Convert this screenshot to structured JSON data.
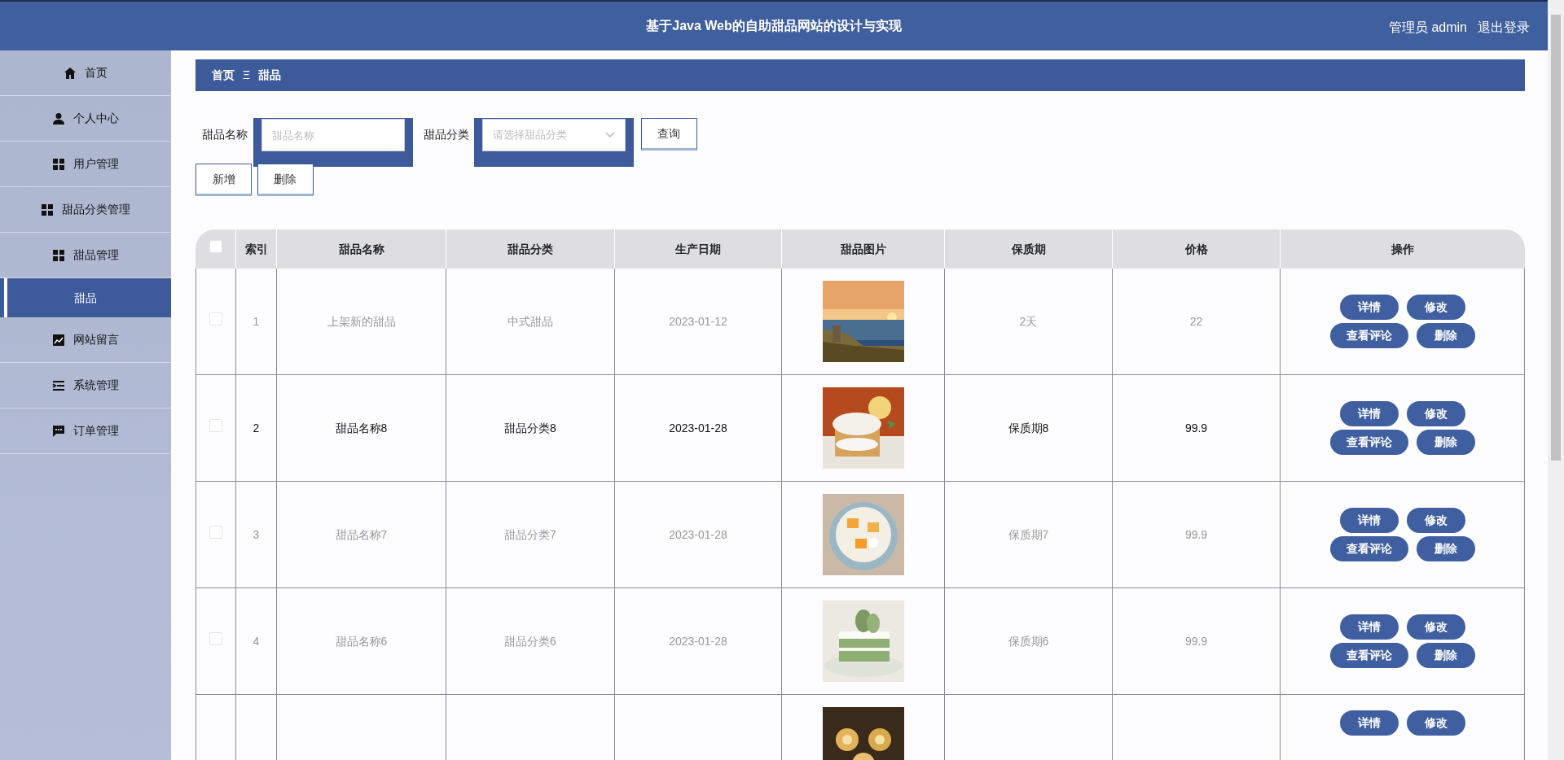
{
  "header": {
    "title": "基于Java Web的自助甜品网站的设计与实现",
    "user": "管理员 admin",
    "logout": "退出登录"
  },
  "sidebar": {
    "items": [
      {
        "label": "首页",
        "selected": false
      },
      {
        "label": "个人中心",
        "selected": false
      },
      {
        "label": "用户管理",
        "selected": false
      },
      {
        "label": "甜品分类管理",
        "selected": false
      },
      {
        "label": "甜品管理",
        "selected": false,
        "children": [
          {
            "label": "甜品",
            "selected": true
          }
        ]
      },
      {
        "label": "网站留言",
        "selected": false
      },
      {
        "label": "系统管理",
        "selected": false
      },
      {
        "label": "订单管理",
        "selected": false
      }
    ]
  },
  "breadcrumb": {
    "items": [
      "首页",
      "甜品"
    ],
    "separator": "Ξ"
  },
  "search": {
    "name_label": "甜品名称",
    "name_placeholder": "甜品名称",
    "category_label": "甜品分类",
    "category_placeholder": "请选择甜品分类",
    "query_button": "查询"
  },
  "toolbar": {
    "buttons": [
      "新增",
      "删除"
    ]
  },
  "table": {
    "select_all": {
      "checked": false
    },
    "columns": [
      "索引",
      "甜品名称",
      "甜品分类",
      "生产日期",
      "甜品图片",
      "保质期",
      "价格",
      "操作"
    ],
    "rows": [
      {
        "checked": false,
        "dimmed": true,
        "index": "1",
        "name": "上架新的甜品",
        "category": "中式甜品",
        "date": "2023-01-12",
        "picture": {
          "kind": "picture"
        },
        "shelf_life": "2天",
        "price": "22",
        "actions": [
          "详情",
          "修改",
          "查看评论",
          "删除"
        ]
      },
      {
        "checked": false,
        "dimmed": false,
        "index": "2",
        "name": "甜品名称8",
        "category": "甜品分类8",
        "date": "2023-01-28",
        "picture": {
          "kind": "picture"
        },
        "shelf_life": "保质期8",
        "price": "99.9",
        "actions": [
          "详情",
          "修改",
          "查看评论",
          "删除"
        ]
      },
      {
        "checked": false,
        "dimmed": true,
        "index": "3",
        "name": "甜品名称7",
        "category": "甜品分类7",
        "date": "2023-01-28",
        "picture": {
          "kind": "picture"
        },
        "shelf_life": "保质期7",
        "price": "99.9",
        "actions": [
          "详情",
          "修改",
          "查看评论",
          "删除"
        ]
      },
      {
        "checked": false,
        "dimmed": true,
        "index": "4",
        "name": "甜品名称6",
        "category": "甜品分类6",
        "date": "2023-01-28",
        "picture": {
          "kind": "picture"
        },
        "shelf_life": "保质期6",
        "price": "99.9",
        "actions": [
          "详情",
          "修改",
          "查看评论",
          "删除"
        ]
      },
      {
        "picture": {
          "kind": "picture"
        },
        "actions": [
          "详情",
          "修改"
        ]
      }
    ]
  }
}
